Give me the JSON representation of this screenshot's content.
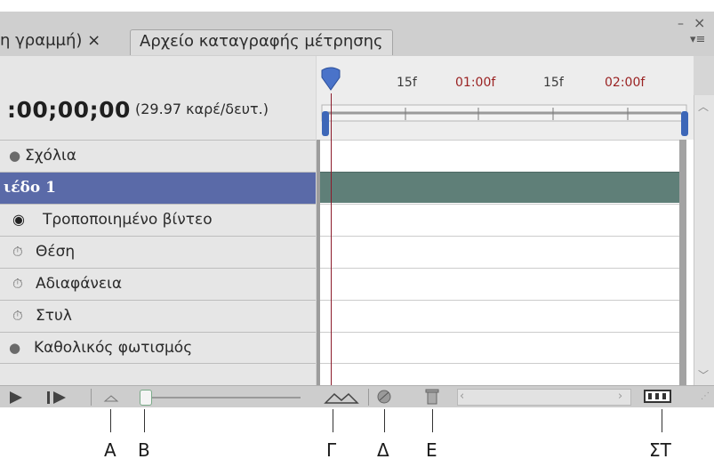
{
  "tabs": [
    {
      "label": "η γραμμή) ×"
    },
    {
      "label": "Αρχείο καταγραφής μέτρησης"
    }
  ],
  "window_controls": {
    "minimize": "–",
    "close": "×",
    "menu": "▾≡"
  },
  "timecode": {
    "value": ":00;00;00",
    "fps": "(29.97 καρέ/δευτ.)"
  },
  "ruler": {
    "ticks": [
      {
        "label": "15f",
        "red": false
      },
      {
        "label": "01:00f",
        "red": true
      },
      {
        "label": "15f",
        "red": false
      },
      {
        "label": "02:00f",
        "red": true
      }
    ]
  },
  "layers": [
    {
      "label": "Σχόλια",
      "icon": "circle-bullet-icon",
      "selected": false
    },
    {
      "label": "ιέδο 1",
      "icon": "",
      "selected": true
    },
    {
      "label": "Τροποποιημένο βίντεο",
      "icon": "eye-icon",
      "selected": false
    },
    {
      "label": "Θέση",
      "icon": "stopwatch-icon",
      "selected": false
    },
    {
      "label": "Αδιαφάνεια",
      "icon": "stopwatch-icon",
      "selected": false
    },
    {
      "label": "Στυλ",
      "icon": "stopwatch-icon",
      "selected": false
    },
    {
      "label": "Καθολικός φωτισμός",
      "icon": "circle-bullet-icon",
      "selected": false
    }
  ],
  "callouts": {
    "a": "A",
    "b": "B",
    "c": "Γ",
    "d": "Δ",
    "e": "E",
    "f": "ΣΤ"
  },
  "colors": {
    "selected_row": "#5a6aa8",
    "clip_bar": "#5f7f78",
    "playhead": "#8c1c2c"
  }
}
